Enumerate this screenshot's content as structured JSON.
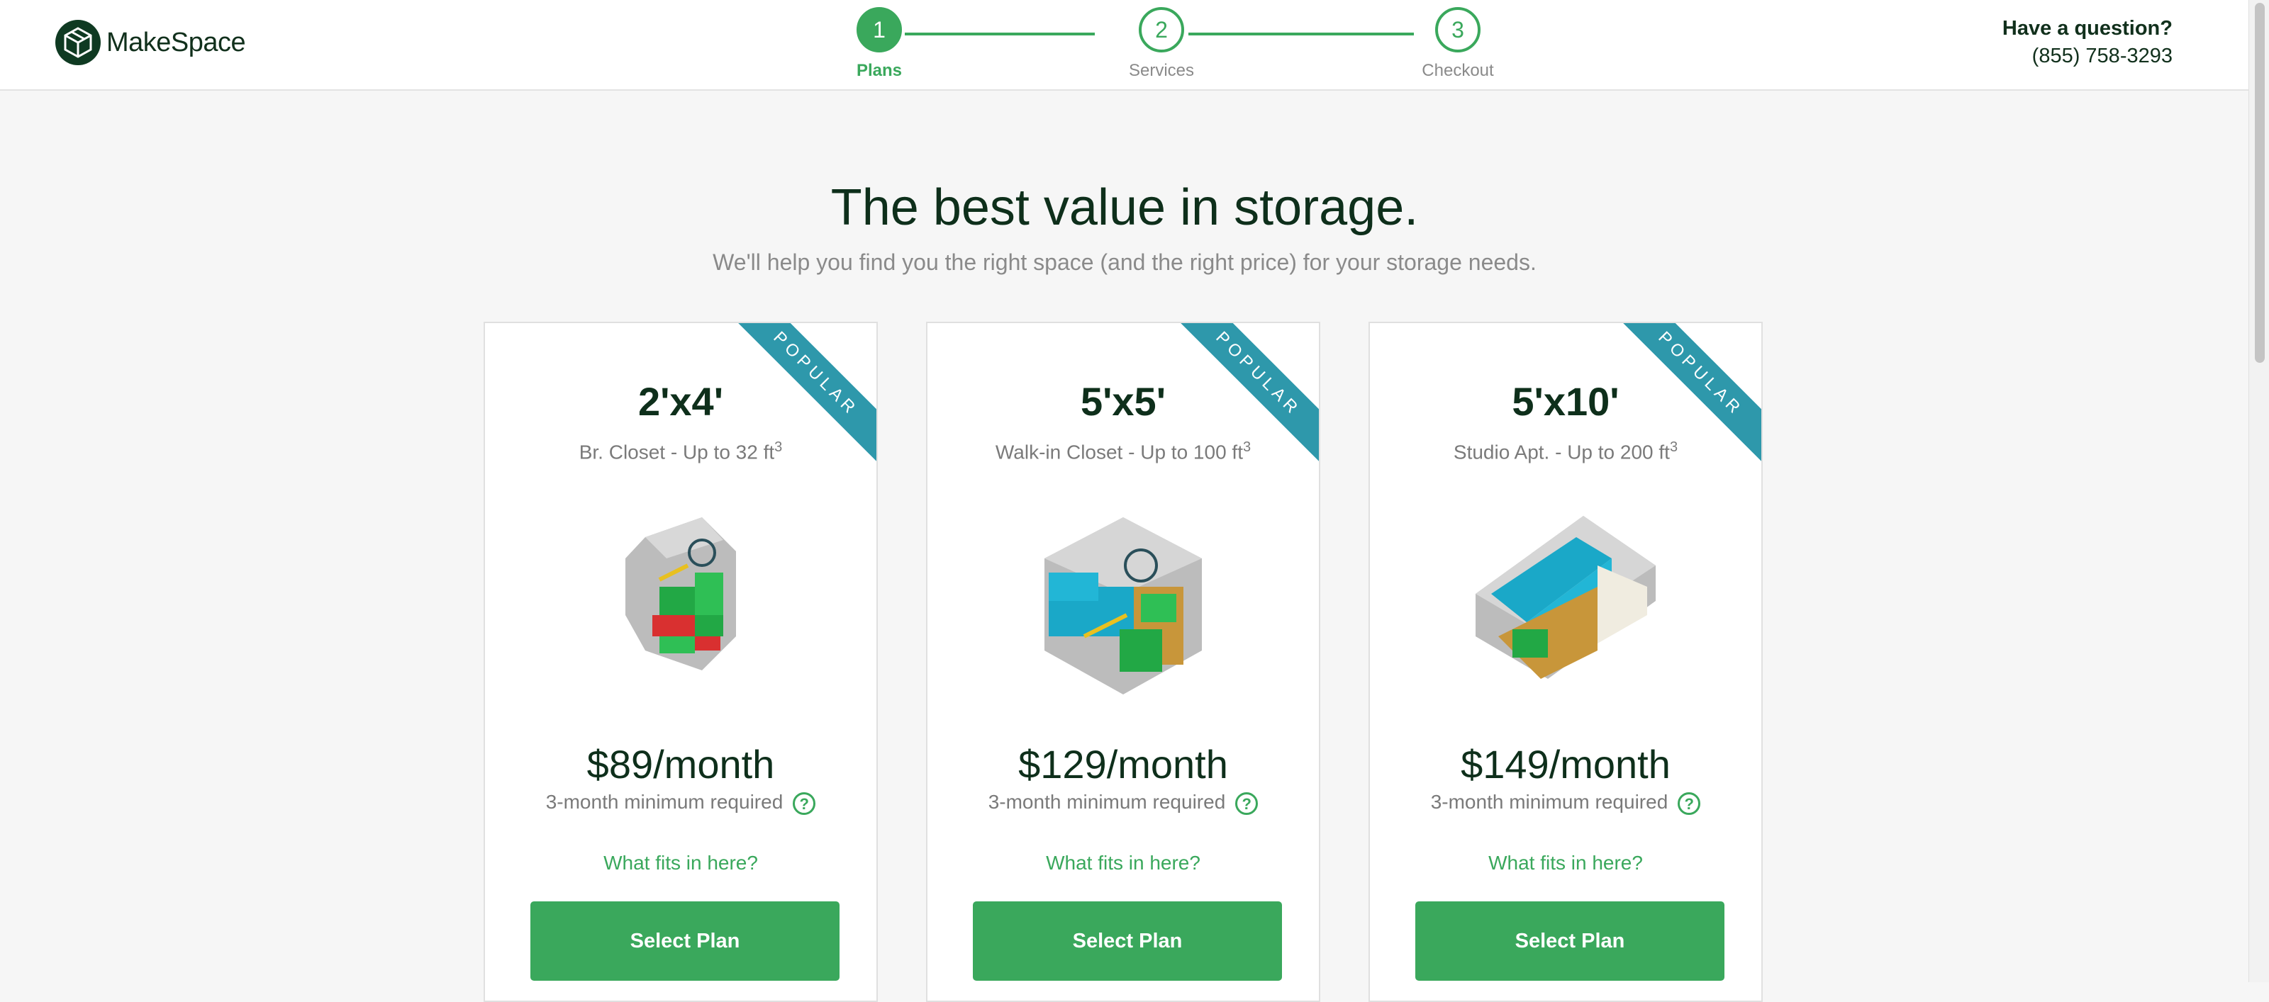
{
  "brand": {
    "name": "MakeSpace"
  },
  "steps": [
    {
      "number": "1",
      "label": "Plans"
    },
    {
      "number": "2",
      "label": "Services"
    },
    {
      "number": "3",
      "label": "Checkout"
    }
  ],
  "contact": {
    "title": "Have a question?",
    "phone": "(855) 758-3293"
  },
  "hero": {
    "title": "The best value in storage.",
    "subtitle": "We'll help you find you the right space (and the right price) for your storage needs."
  },
  "plans": [
    {
      "ribbon": "POPULAR",
      "size": "2'x4'",
      "description": "Br. Closet - Up to 32 ft",
      "unit_exp": "3",
      "price": "$89/month",
      "minimum": "3-month minimum required",
      "help_icon": "?",
      "fits_link": "What fits in here?",
      "button": "Select Plan"
    },
    {
      "ribbon": "POPULAR",
      "size": "5'x5'",
      "description": "Walk-in Closet - Up to 100 ft",
      "unit_exp": "3",
      "price": "$129/month",
      "minimum": "3-month minimum required",
      "help_icon": "?",
      "fits_link": "What fits in here?",
      "button": "Select Plan"
    },
    {
      "ribbon": "POPULAR",
      "size": "5'x10'",
      "description": "Studio Apt. - Up to 200 ft",
      "unit_exp": "3",
      "price": "$149/month",
      "minimum": "3-month minimum required",
      "help_icon": "?",
      "fits_link": "What fits in here?",
      "button": "Select Plan"
    }
  ],
  "colors": {
    "brand_green": "#3aa85c",
    "dark_green": "#0e2f1b",
    "ribbon_teal": "#2e98ab",
    "background": "#f6f6f6"
  }
}
